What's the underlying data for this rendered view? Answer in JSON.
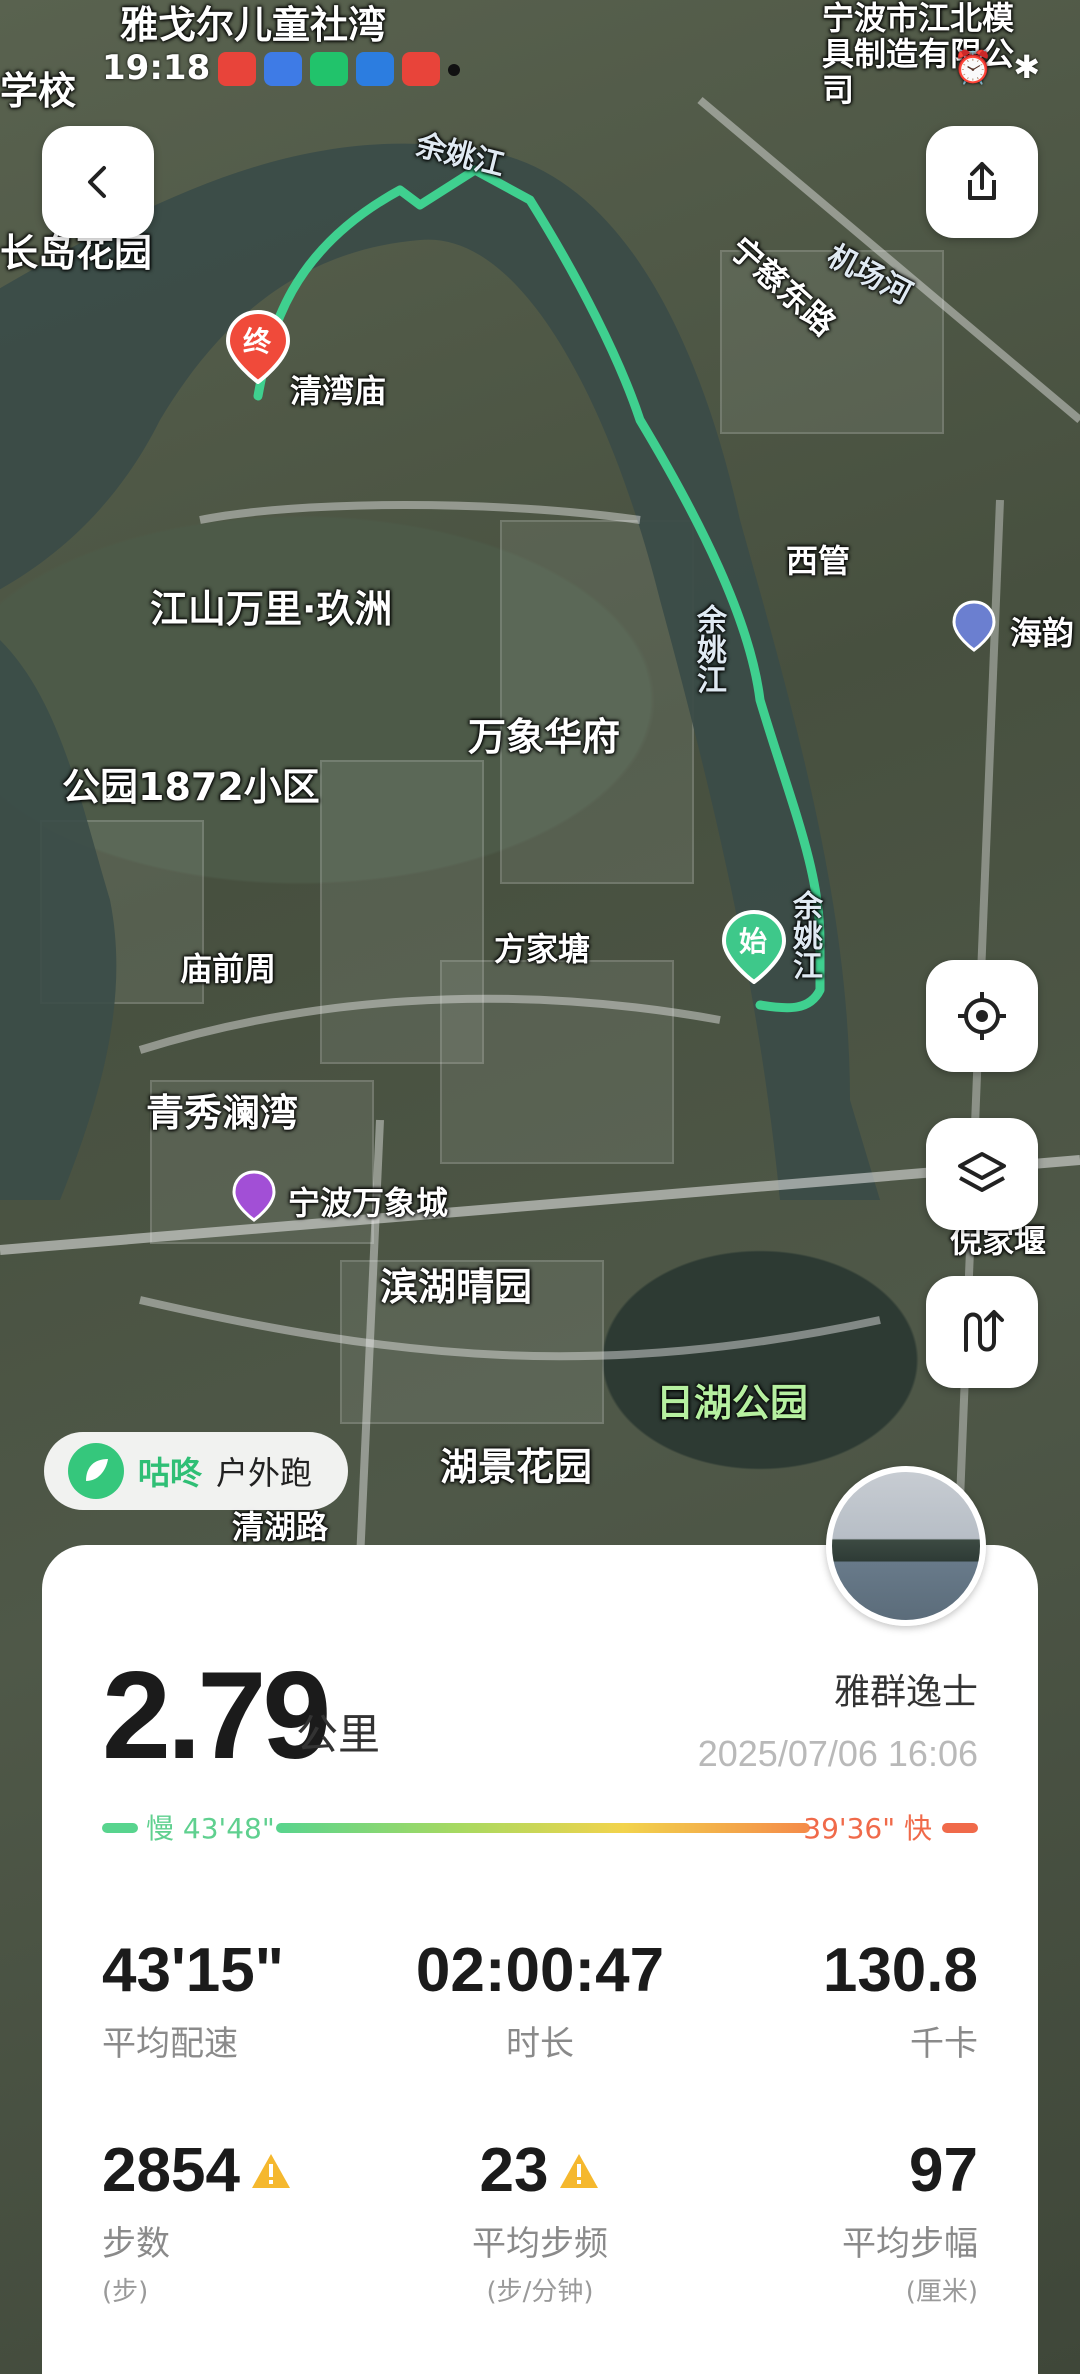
{
  "status_bar": {
    "time": "19:18"
  },
  "map": {
    "labels": {
      "yabowan": "雅戈尔儿童社湾",
      "xiaoxiao": "学校",
      "changdao": "长岛花园",
      "qingwan_temple": "清湾庙",
      "jiangshan": "江山万里·玖洲",
      "wanxiang_fu": "万象华府",
      "park1872": "公园1872小区",
      "miaoqian": "庙前周",
      "fangjiatang": "方家塘",
      "qingxiu": "青秀澜湾",
      "wanxiang_city": "宁波万象城",
      "binhu": "滨湖晴园",
      "rihu_park": "日湖公园",
      "hujing": "湖景花园",
      "xiguan": "西管",
      "haiyun": "海韵",
      "nijiayan": "倪家堰",
      "company": "宁波市江北模具制造有限公司",
      "jichang_river": "机场河",
      "ningci_road": "宁慈东路",
      "qinghu_road": "清湖路",
      "yuyao_river_1": "余姚江",
      "yuyao_river_2": "余姚江",
      "yuyao_river_3": "余姚江",
      "start_marker": "始",
      "end_marker": "终"
    }
  },
  "badge": {
    "brand": "咕咚",
    "kind": "户外跑"
  },
  "summary": {
    "distance": "2.79",
    "distance_unit": "公里",
    "user_name": "雅群逸士",
    "datetime": "2025/07/06 16:06",
    "pace_slow_label": "慢 43'48\"",
    "pace_fast_label": "39'36\" 快"
  },
  "stats": [
    {
      "value": "43'15\"",
      "label": "平均配速",
      "unit": "",
      "warn": false
    },
    {
      "value": "02:00:47",
      "label": "时长",
      "unit": "",
      "warn": false
    },
    {
      "value": "130.8",
      "label": "千卡",
      "unit": "",
      "warn": false
    },
    {
      "value": "2854",
      "label": "步数",
      "unit": "(步)",
      "warn": true
    },
    {
      "value": "23",
      "label": "平均步频",
      "unit": "(步/分钟)",
      "warn": true
    },
    {
      "value": "97",
      "label": "平均步幅",
      "unit": "(厘米)",
      "warn": false
    }
  ],
  "colors": {
    "route": "#3fd08f",
    "brand": "#2fbf75",
    "end_marker": "#f04a3a",
    "start_marker": "#3ec88a",
    "warn": "#f5b82e"
  }
}
